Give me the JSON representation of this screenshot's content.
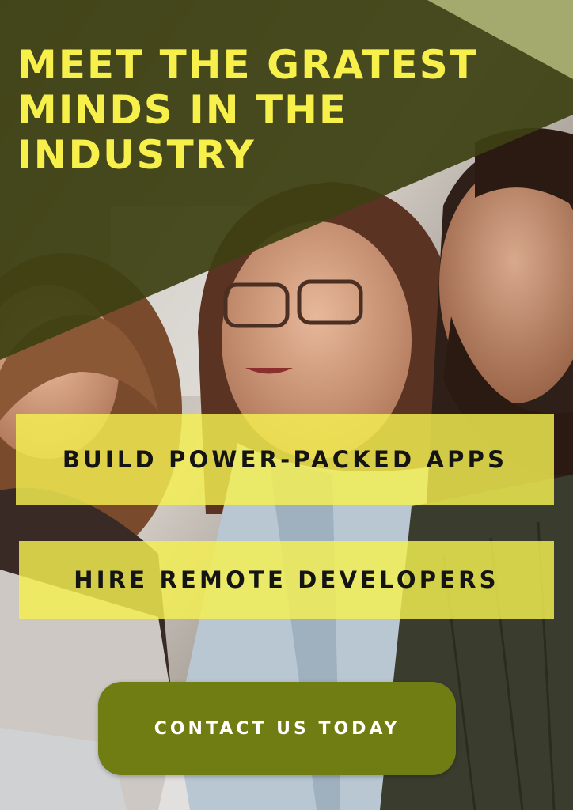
{
  "poster": {
    "headline": "MEET THE GRATEST MINDS IN THE INDUSTRY",
    "features": [
      {
        "label": "BUILD POWER-PACKED APPS"
      },
      {
        "label": "HIRE REMOTE DEVELOPERS"
      }
    ],
    "cta_label": "CONTACT US TODAY"
  },
  "colors": {
    "banner_olive": "#3f4414",
    "banner_corner": "#a4a96e",
    "headline_yellow": "#f7f04a",
    "feature_box_yellow": "#f5f050",
    "button_olive": "#6f7d13",
    "button_text": "#ffffff"
  },
  "background_photo": {
    "subject": "people-at-meeting-photo"
  }
}
